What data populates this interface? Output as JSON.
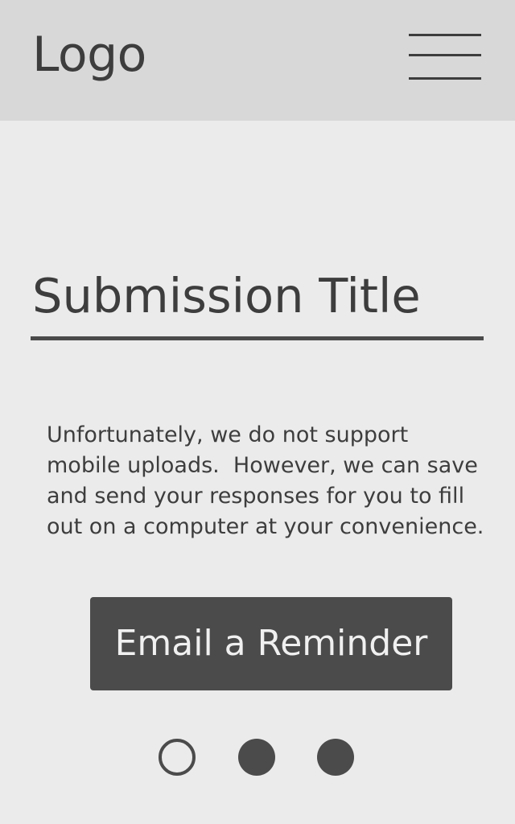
{
  "header": {
    "logo_text": "Logo",
    "menu_icon": "hamburger-menu-icon"
  },
  "main": {
    "title": "Submission Title",
    "message": "Unfortunately, we do not support mobile uploads.  However, we can save and send your responses for you to fill out on a computer at your convenience.",
    "button_label": "Email a Reminder"
  },
  "pagination": {
    "total": 3,
    "current": 1
  },
  "colors": {
    "header_bg": "#d8d8d8",
    "page_bg": "#ebebeb",
    "text": "#3d3d3d",
    "button_bg": "#4b4b4b",
    "button_text": "#f0f0f0"
  }
}
